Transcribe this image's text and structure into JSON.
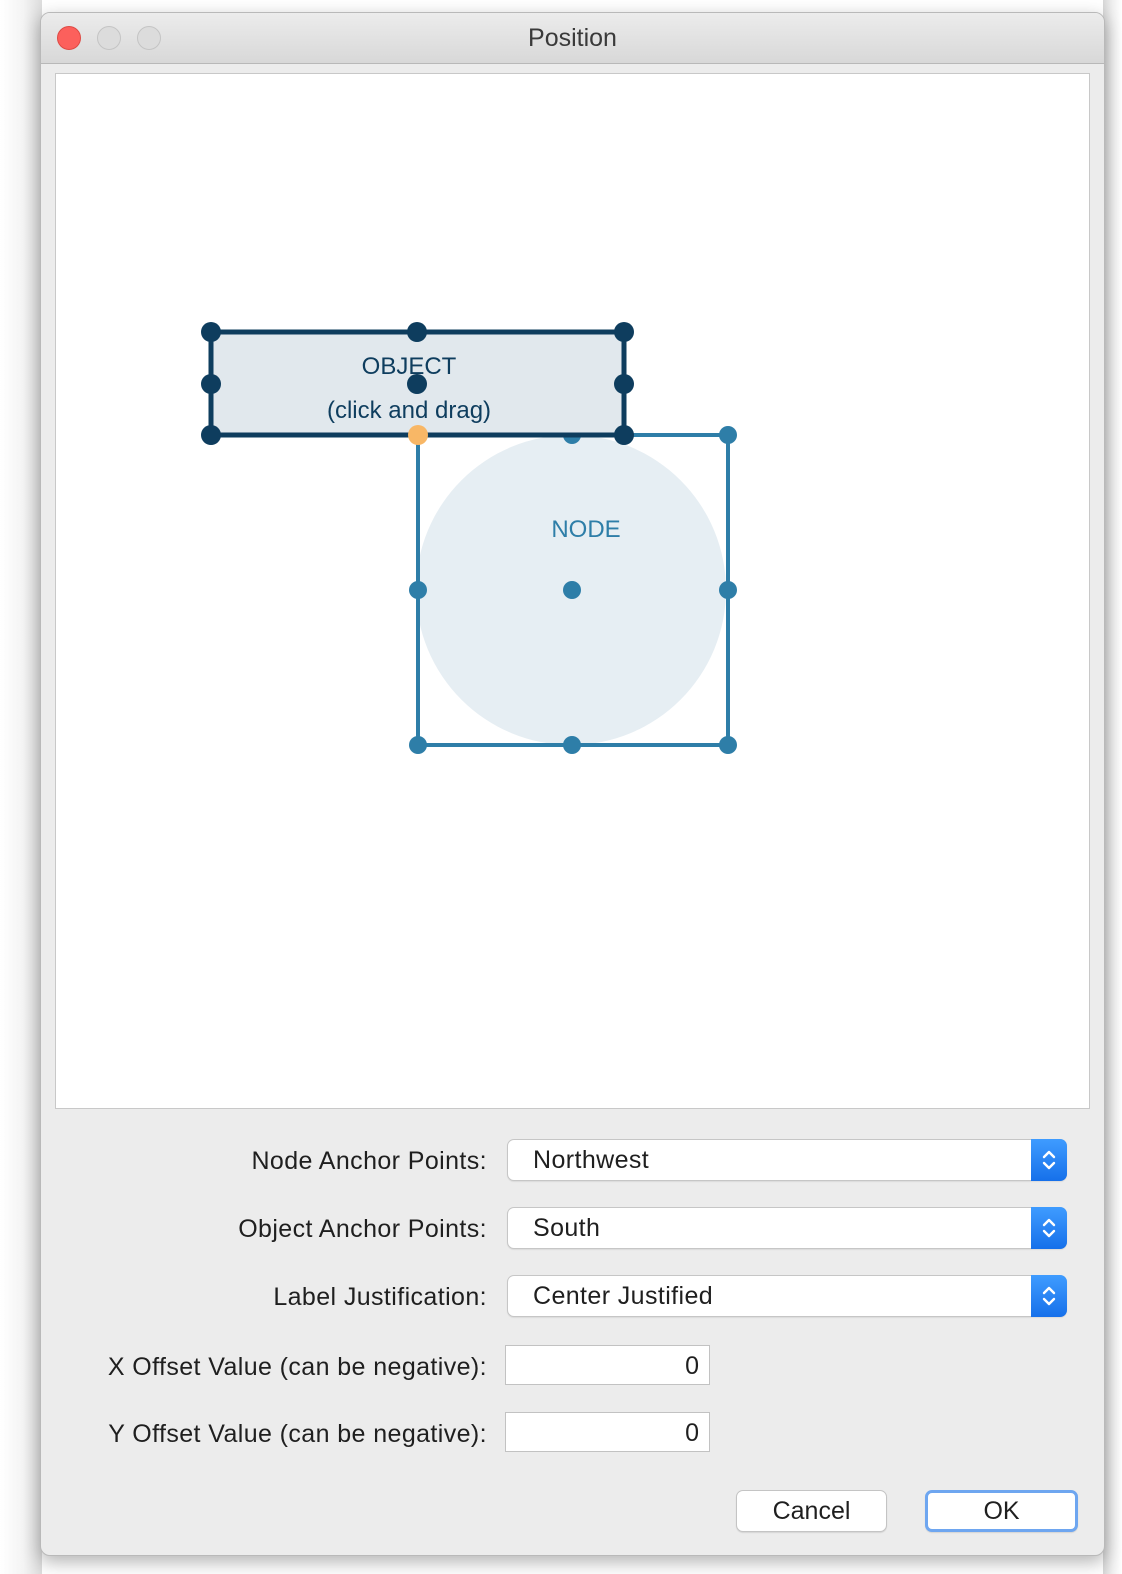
{
  "window": {
    "title": "Position"
  },
  "canvas": {
    "object_label_line1": "OBJECT",
    "object_label_line2": "(click and drag)",
    "node_label": "NODE",
    "colors": {
      "object_stroke": "#0e3d5e",
      "object_fill": "#e1e8ed",
      "node_stroke": "#2e7ea8",
      "node_fill": "#e6eef3",
      "anchor_highlight": "#f8b766"
    }
  },
  "form": {
    "node_anchor": {
      "label": "Node Anchor Points:",
      "value": "Northwest"
    },
    "object_anchor": {
      "label": "Object Anchor Points:",
      "value": "South"
    },
    "label_justification": {
      "label": "Label Justification:",
      "value": "Center Justified"
    },
    "x_offset": {
      "label": "X Offset Value (can be negative):",
      "value": "0"
    },
    "y_offset": {
      "label": "Y Offset Value (can be negative):",
      "value": "0"
    }
  },
  "buttons": {
    "cancel": "Cancel",
    "ok": "OK"
  },
  "icons": {
    "close": "close-traffic-light",
    "minimize": "minimize-traffic-light",
    "maximize": "maximize-traffic-light",
    "stepper": "up-down-chevron-icon"
  }
}
